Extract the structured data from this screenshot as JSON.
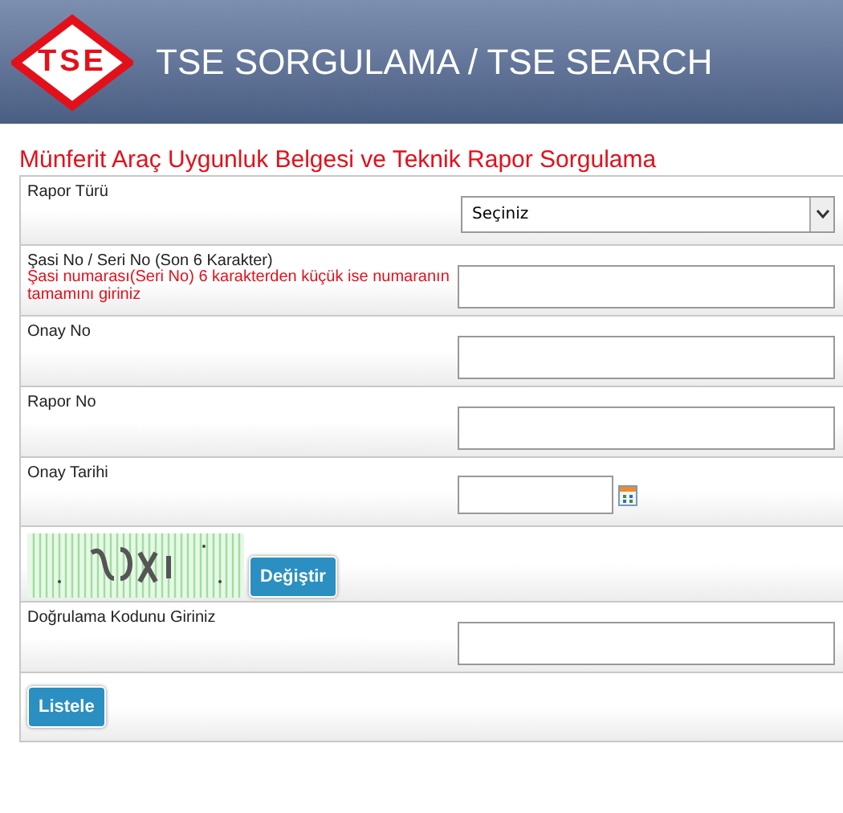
{
  "header": {
    "logo": "TSE",
    "title": "TSE SORGULAMA / TSE SEARCH"
  },
  "page_title": "Münferit Araç Uygunluk Belgesi ve Teknik Rapor Sorgulama",
  "form": [
    {
      "kind": "select",
      "label": "Rapor Türü",
      "value": "Seçiniz"
    },
    {
      "kind": "text",
      "label": "Şasi No / Seri No (Son 6 Karakter)",
      "hint": "Şasi numarası(Seri No) 6 karakterden küçük ise numaranın tamamını giriniz"
    },
    {
      "kind": "text",
      "label": "Onay No"
    },
    {
      "kind": "text",
      "label": "Rapor No"
    },
    {
      "kind": "date",
      "label": "Onay Tarihi"
    },
    {
      "kind": "captcha",
      "button": "Değiştir"
    },
    {
      "kind": "text",
      "label": "Doğrulama Kodunu Giriniz"
    },
    {
      "kind": "button",
      "button": "Listele"
    }
  ]
}
